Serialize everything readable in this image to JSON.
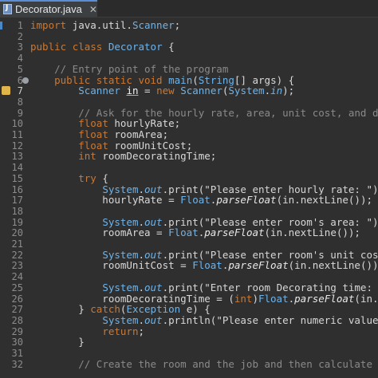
{
  "tab": {
    "label": "Decorator.java",
    "close": "✕"
  },
  "lines": [
    {
      "n": "1",
      "code": "import java.util.Scanner;"
    },
    {
      "n": "2",
      "code": ""
    },
    {
      "n": "3",
      "code": "public class Decorator {"
    },
    {
      "n": "4",
      "code": ""
    },
    {
      "n": "5",
      "code": "    // Entry point of the program"
    },
    {
      "n": "6",
      "code": "    public static void main(String[] args) {"
    },
    {
      "n": "7",
      "code": "        Scanner in = new Scanner(System.in);"
    },
    {
      "n": "8",
      "code": ""
    },
    {
      "n": "9",
      "code": "        // Ask for the hourly rate, area, unit cost, and decorating"
    },
    {
      "n": "10",
      "code": "        float hourlyRate;"
    },
    {
      "n": "11",
      "code": "        float roomArea;"
    },
    {
      "n": "12",
      "code": "        float roomUnitCost;"
    },
    {
      "n": "13",
      "code": "        int roomDecoratingTime;"
    },
    {
      "n": "14",
      "code": ""
    },
    {
      "n": "15",
      "code": "        try {"
    },
    {
      "n": "16",
      "code": "            System.out.print(\"Please enter hourly rate: \");"
    },
    {
      "n": "17",
      "code": "            hourlyRate = Float.parseFloat(in.nextLine());"
    },
    {
      "n": "18",
      "code": ""
    },
    {
      "n": "19",
      "code": "            System.out.print(\"Please enter room's area: \");"
    },
    {
      "n": "20",
      "code": "            roomArea = Float.parseFloat(in.nextLine());"
    },
    {
      "n": "21",
      "code": ""
    },
    {
      "n": "22",
      "code": "            System.out.print(\"Please enter room's unit cost: \");"
    },
    {
      "n": "23",
      "code": "            roomUnitCost = Float.parseFloat(in.nextLine());"
    },
    {
      "n": "24",
      "code": ""
    },
    {
      "n": "25",
      "code": "            System.out.print(\"Enter room Decorating time: \");"
    },
    {
      "n": "26",
      "code": "            roomDecoratingTime = (int)Float.parseFloat(in.nextLine"
    },
    {
      "n": "27",
      "code": "        } catch(Exception e) {"
    },
    {
      "n": "28",
      "code": "            System.out.println(\"Please enter numeric values only.\""
    },
    {
      "n": "29",
      "code": "            return;"
    },
    {
      "n": "30",
      "code": "        }"
    },
    {
      "n": "31",
      "code": ""
    },
    {
      "n": "32",
      "code": "        // Create the room and the job and then calculate the cost"
    }
  ],
  "colors": {
    "background": "#2f2f2f",
    "keyword": "#cc7832",
    "type": "#6fb3e8",
    "comment": "#8a8a8a",
    "text": "#d9d9d9"
  }
}
